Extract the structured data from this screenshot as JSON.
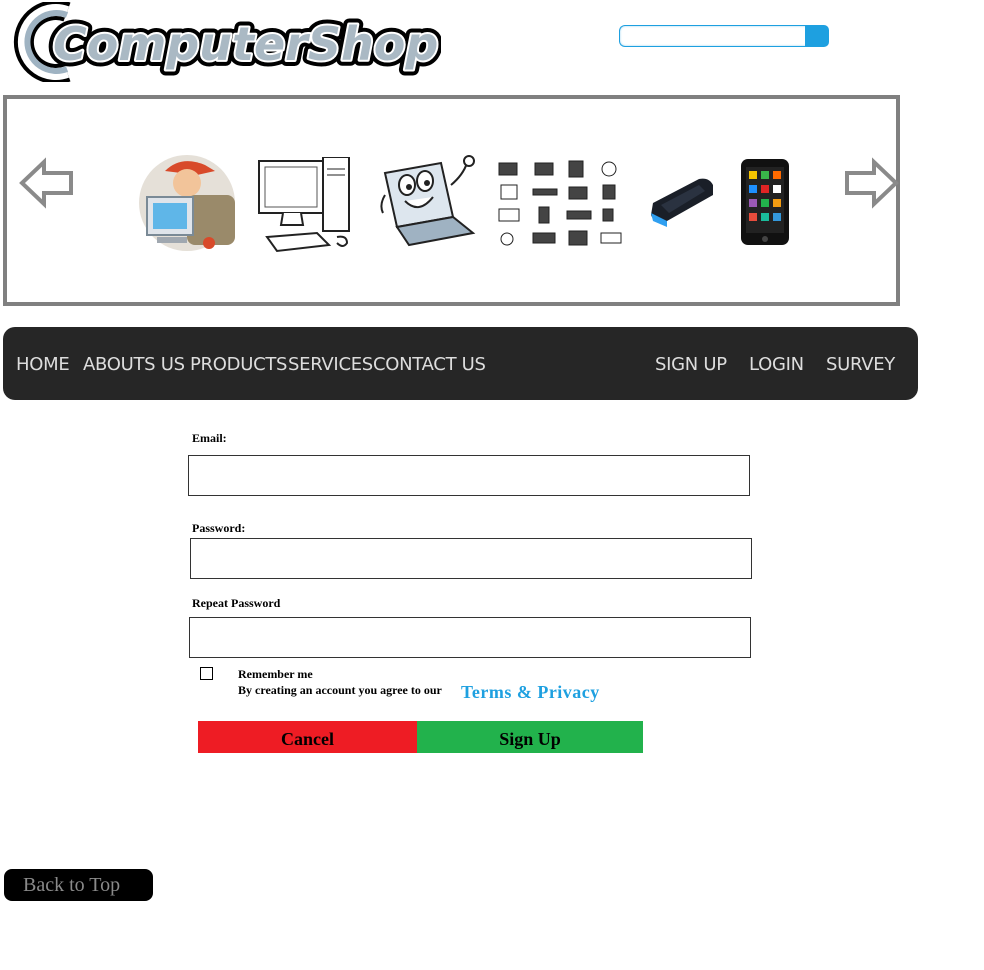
{
  "brand": {
    "logo_text": "ComputerShop"
  },
  "search": {
    "value": "",
    "placeholder": ""
  },
  "slider": {
    "items": [
      {
        "icon": "technician-repair-icon"
      },
      {
        "icon": "desktop-computer-icon"
      },
      {
        "icon": "cartoon-laptop-icon"
      },
      {
        "icon": "electronics-grid-icon"
      },
      {
        "icon": "smartphone-icon"
      },
      {
        "icon": "tablet-icon"
      }
    ]
  },
  "nav": {
    "left": [
      "HOME",
      "ABOUTS US",
      "PRODUCTS",
      "SERVICES",
      "CONTACT US"
    ],
    "right": [
      "SIGN UP",
      "LOGIN",
      "SURVEY"
    ]
  },
  "form": {
    "email_label": "Email:",
    "email_value": "",
    "password_label": "Password:",
    "password_value": "",
    "repeat_label": "Repeat Password",
    "repeat_value": "",
    "remember_label": "Remember me",
    "remember_checked": false,
    "agree_text": "By creating an account you agree to our",
    "terms_link": "Terms & Privacy",
    "cancel_label": "Cancel",
    "signup_label": "Sign Up"
  },
  "footer": {
    "back_to_top": "Back to Top"
  },
  "colors": {
    "accent": "#1ea0e0",
    "nav_bg": "#262626",
    "cancel": "#ee1c24",
    "signup": "#22b24c"
  }
}
